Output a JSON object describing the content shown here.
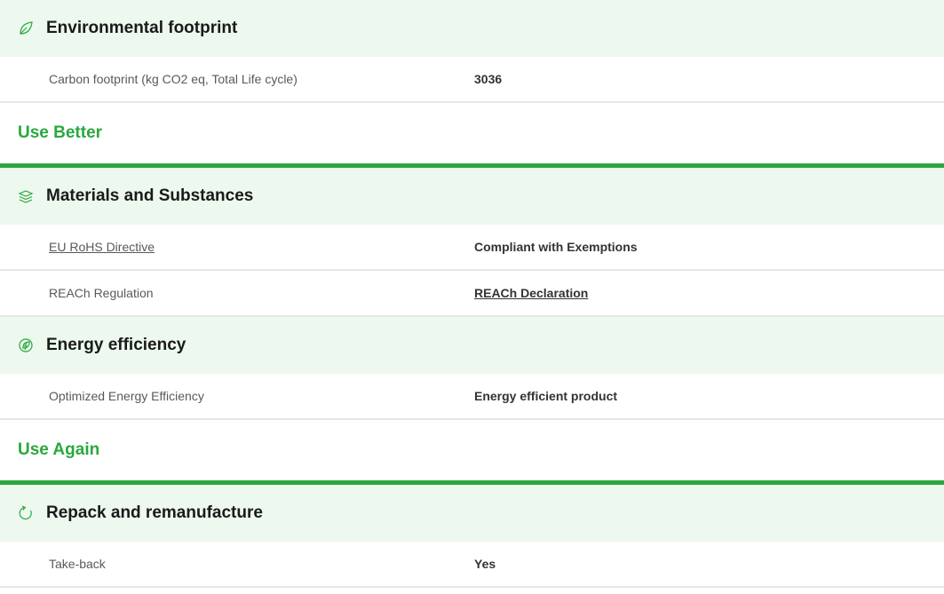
{
  "colors": {
    "accent_green": "#2aa83e",
    "header_bg": "#edf8ee",
    "link_blue": "#1a7bc1"
  },
  "blocks": {
    "environmental": {
      "title": "Environmental footprint",
      "icon": "leaf-icon",
      "rows": [
        {
          "label": "Carbon footprint (kg CO2 eq, Total Life cycle)",
          "value": "3036"
        }
      ]
    },
    "use_better": {
      "heading": "Use Better",
      "materials": {
        "title": "Materials and Substances",
        "icon": "layers-icon",
        "rows": [
          {
            "label": "EU RoHS Directive",
            "value": "Compliant with Exemptions"
          },
          {
            "label": "REACh Regulation",
            "value": "REACh Declaration"
          }
        ]
      },
      "energy": {
        "title": "Energy efficiency",
        "icon": "energy-leaf-icon",
        "rows": [
          {
            "label": "Optimized Energy Efficiency",
            "value": "Energy efficient product"
          }
        ]
      }
    },
    "use_again": {
      "heading": "Use Again",
      "repack": {
        "title": "Repack and remanufacture",
        "icon": "refresh-icon",
        "rows": [
          {
            "label": "Take-back",
            "value": "Yes"
          }
        ]
      }
    }
  }
}
